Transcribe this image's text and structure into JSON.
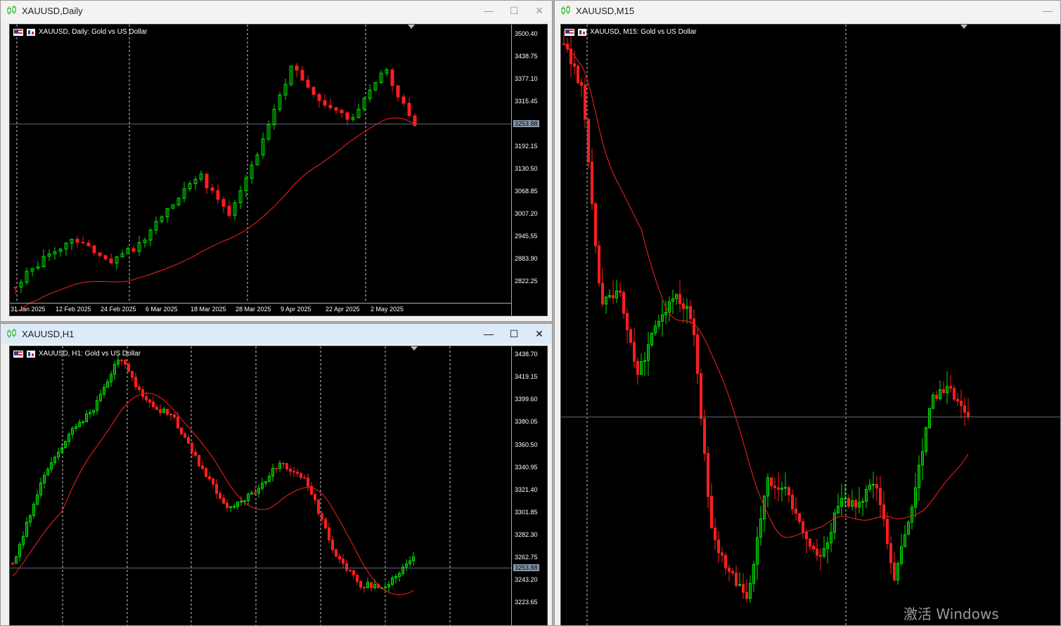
{
  "windows": {
    "daily": {
      "title": "XAUUSD,Daily",
      "label": "XAUUSD, Daily:  Gold vs US Dollar",
      "price_tag": "3253.88",
      "yticks": [
        "3500.40",
        "3438.75",
        "3377.10",
        "3315.45",
        "3253.88",
        "3192.15",
        "3130.50",
        "3068.85",
        "3007.20",
        "2945.55",
        "2883.90",
        "2822.25"
      ],
      "xticks": [
        "31 Jan 2025",
        "12 Feb 2025",
        "24 Feb 2025",
        "6 Mar 2025",
        "18 Mar 2025",
        "28 Mar 2025",
        "9 Apr 2025",
        "22 Apr 2025",
        "2 May 2025"
      ]
    },
    "h1": {
      "title": "XAUUSD,H1",
      "label": "XAUUSD, H1:  Gold vs US Dollar",
      "price_tag": "3253.88",
      "yticks": [
        "3438.70",
        "3419.15",
        "3399.60",
        "3380.05",
        "3360.50",
        "3340.95",
        "3321.40",
        "3301.85",
        "3282.30",
        "3262.75",
        "3253.88",
        "3243.20",
        "3223.65"
      ]
    },
    "m15": {
      "title": "XAUUSD,M15",
      "label": "XAUUSD, M15:  Gold vs US Dollar"
    }
  },
  "window_buttons": {
    "minimize": "—",
    "maximize": "☐",
    "close": "✕"
  },
  "watermark": "激活 Windows",
  "colors": {
    "bull": "#00e000",
    "bear": "#ff1e1e",
    "ma": "#ff2020",
    "background": "#000000"
  },
  "icons": {
    "chart_window": "candlestick-icon",
    "label_flag": "us-flag-icon",
    "label_contract": "chart-type-icon"
  }
}
